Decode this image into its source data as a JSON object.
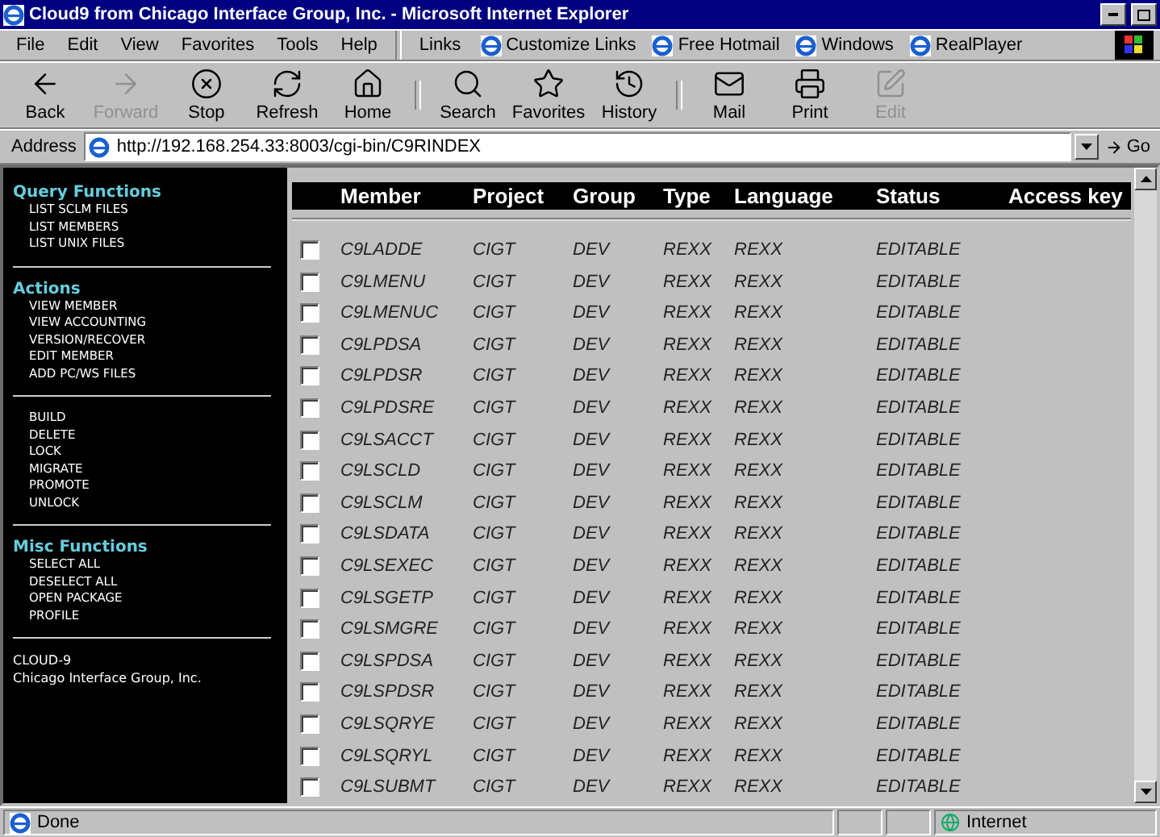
{
  "window": {
    "title": "Cloud9 from Chicago Interface Group, Inc. - Microsoft Internet Explorer"
  },
  "menu": [
    "File",
    "Edit",
    "View",
    "Favorites",
    "Tools",
    "Help"
  ],
  "links": {
    "label": "Links",
    "items": [
      "Customize Links",
      "Free Hotmail",
      "Windows",
      "RealPlayer"
    ]
  },
  "toolbar": [
    {
      "label": "Back",
      "kind": "back",
      "disabled": false
    },
    {
      "label": "Forward",
      "kind": "forward",
      "disabled": true
    },
    {
      "label": "Stop",
      "kind": "stop",
      "disabled": false
    },
    {
      "label": "Refresh",
      "kind": "refresh",
      "disabled": false
    },
    {
      "label": "Home",
      "kind": "home",
      "disabled": false
    },
    {
      "label": "Search",
      "kind": "search",
      "disabled": false
    },
    {
      "label": "Favorites",
      "kind": "favorites",
      "disabled": false
    },
    {
      "label": "History",
      "kind": "history",
      "disabled": false
    },
    {
      "label": "Mail",
      "kind": "mail",
      "disabled": false
    },
    {
      "label": "Print",
      "kind": "print",
      "disabled": false
    },
    {
      "label": "Edit",
      "kind": "edit",
      "disabled": true
    }
  ],
  "address": {
    "label": "Address",
    "value": "http://192.168.254.33:8003/cgi-bin/C9RINDEX",
    "go": "Go"
  },
  "sidebar": [
    {
      "title": "Query Functions",
      "items": [
        "LIST SCLM FILES",
        "LIST MEMBERS",
        "LIST UNIX FILES"
      ]
    },
    {
      "title": "Actions",
      "items": [
        "VIEW MEMBER",
        "VIEW ACCOUNTING",
        "VERSION/RECOVER",
        "EDIT MEMBER",
        "ADD PC/WS FILES"
      ]
    },
    {
      "items": [
        "BUILD",
        "DELETE",
        "LOCK",
        "MIGRATE",
        "PROMOTE",
        "UNLOCK"
      ]
    },
    {
      "title": "Misc Functions",
      "items": [
        "SELECT ALL",
        "DESELECT ALL",
        "OPEN PACKAGE",
        "PROFILE"
      ]
    }
  ],
  "footer": [
    "CLOUD-9",
    "Chicago Interface Group, Inc."
  ],
  "table": {
    "columns": [
      "Member",
      "Project",
      "Group",
      "Type",
      "Language",
      "Status",
      "Access key"
    ],
    "rows": [
      {
        "checked": false,
        "cells": [
          "C9LADDE",
          "CIGT",
          "DEV",
          "REXX",
          "REXX",
          "EDITABLE"
        ]
      },
      {
        "checked": false,
        "cells": [
          "C9LMENU",
          "CIGT",
          "DEV",
          "REXX",
          "REXX",
          "EDITABLE"
        ]
      },
      {
        "checked": false,
        "cells": [
          "C9LMENUC",
          "CIGT",
          "DEV",
          "REXX",
          "REXX",
          "EDITABLE"
        ]
      },
      {
        "checked": false,
        "cells": [
          "C9LPDSA",
          "CIGT",
          "DEV",
          "REXX",
          "REXX",
          "EDITABLE"
        ]
      },
      {
        "checked": false,
        "cells": [
          "C9LPDSR",
          "CIGT",
          "DEV",
          "REXX",
          "REXX",
          "EDITABLE"
        ]
      },
      {
        "checked": false,
        "cells": [
          "C9LPDSRE",
          "CIGT",
          "DEV",
          "REXX",
          "REXX",
          "EDITABLE"
        ]
      },
      {
        "checked": false,
        "cells": [
          "C9LSACCT",
          "CIGT",
          "DEV",
          "REXX",
          "REXX",
          "EDITABLE"
        ]
      },
      {
        "checked": false,
        "cells": [
          "C9LSCLD",
          "CIGT",
          "DEV",
          "REXX",
          "REXX",
          "EDITABLE"
        ]
      },
      {
        "checked": false,
        "cells": [
          "C9LSCLM",
          "CIGT",
          "DEV",
          "REXX",
          "REXX",
          "EDITABLE"
        ]
      },
      {
        "checked": false,
        "cells": [
          "C9LSDATA",
          "CIGT",
          "DEV",
          "REXX",
          "REXX",
          "EDITABLE"
        ]
      },
      {
        "checked": false,
        "cells": [
          "C9LSEXEC",
          "CIGT",
          "DEV",
          "REXX",
          "REXX",
          "EDITABLE"
        ]
      },
      {
        "checked": false,
        "cells": [
          "C9LSGETP",
          "CIGT",
          "DEV",
          "REXX",
          "REXX",
          "EDITABLE"
        ]
      },
      {
        "checked": false,
        "cells": [
          "C9LSMGRE",
          "CIGT",
          "DEV",
          "REXX",
          "REXX",
          "EDITABLE"
        ]
      },
      {
        "checked": false,
        "cells": [
          "C9LSPDSA",
          "CIGT",
          "DEV",
          "REXX",
          "REXX",
          "EDITABLE"
        ]
      },
      {
        "checked": false,
        "cells": [
          "C9LSPDSR",
          "CIGT",
          "DEV",
          "REXX",
          "REXX",
          "EDITABLE"
        ]
      },
      {
        "checked": false,
        "cells": [
          "C9LSQRYE",
          "CIGT",
          "DEV",
          "REXX",
          "REXX",
          "EDITABLE"
        ]
      },
      {
        "checked": false,
        "cells": [
          "C9LSQRYL",
          "CIGT",
          "DEV",
          "REXX",
          "REXX",
          "EDITABLE"
        ]
      },
      {
        "checked": false,
        "cells": [
          "C9LSUBMT",
          "CIGT",
          "DEV",
          "REXX",
          "REXX",
          "EDITABLE"
        ]
      }
    ]
  },
  "status_bar": {
    "text": "Done",
    "zone": "Internet"
  }
}
